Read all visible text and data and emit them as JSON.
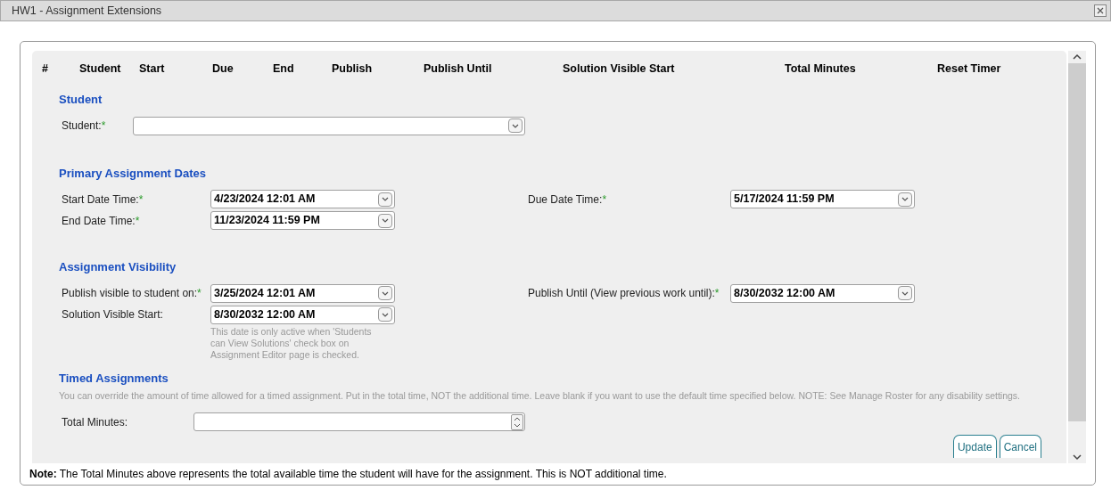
{
  "window": {
    "title": "HW1 - Assignment Extensions"
  },
  "table": {
    "columns": [
      "#",
      "Student",
      "Start",
      "Due",
      "End",
      "Publish",
      "Publish Until",
      "Solution Visible Start",
      "Total Minutes",
      "Reset Timer"
    ]
  },
  "sections": [
    {
      "title": "Student",
      "rows": [
        [
          {
            "label": "Student:",
            "required_mark": "*",
            "kind": "select"
          }
        ]
      ]
    },
    {
      "title": "Primary Assignment Dates",
      "rows": [
        [
          {
            "label": "Start Date Time:",
            "required_mark": "*",
            "kind": "date",
            "value": "4/23/2024 12:01 AM"
          },
          {
            "label": "Due Date Time:",
            "required_mark": "*",
            "kind": "date",
            "value": "5/17/2024 11:59 PM"
          }
        ],
        [
          {
            "label": "End Date Time:",
            "required_mark": "*",
            "kind": "date",
            "value": "11/23/2024 11:59 PM"
          }
        ]
      ]
    },
    {
      "title": "Assignment Visibility",
      "rows": [
        [
          {
            "label": "Publish visible to student on:",
            "required_mark": "*",
            "kind": "date",
            "value": "3/25/2024 12:01 AM"
          },
          {
            "label": "Publish Until (View previous work until):",
            "required_mark": "*",
            "kind": "date",
            "value": "8/30/2032 12:00 AM"
          }
        ],
        [
          {
            "label": "Solution Visible Start:",
            "kind": "date",
            "value": "8/30/2032 12:00 AM",
            "hint": "This date is only active when 'Students can View Solutions' check box on Assignment Editor page is checked."
          }
        ]
      ]
    },
    {
      "title": "Timed Assignments",
      "description": "You can override the amount of time allowed for a timed assignment. Put in the total time, NOT the additional time. Leave blank if you want to use the default time specified below. NOTE: See Manage Roster for any disability settings.",
      "rows": [
        [
          {
            "label": "Total Minutes:",
            "kind": "number"
          }
        ]
      ]
    }
  ],
  "buttons": [
    "Update",
    "Cancel"
  ],
  "note": "**Note:** The Total Minutes above represents the total available time the student will have for the assignment. This is NOT additional time."
}
